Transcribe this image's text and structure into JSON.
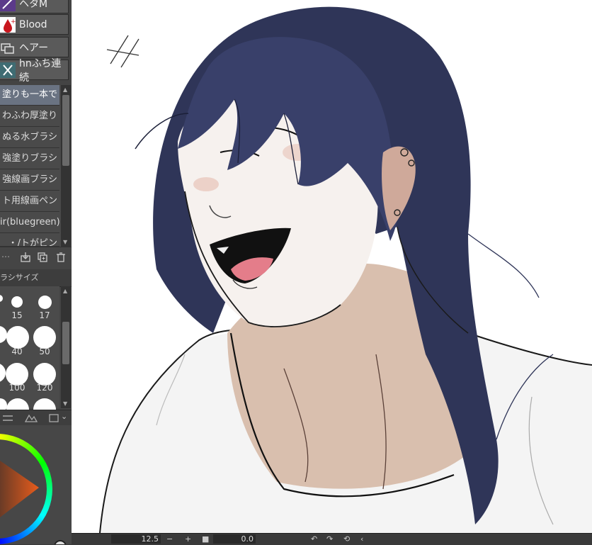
{
  "sub_tools": [
    {
      "label": "ヘタM",
      "icon": "feather-brush-icon"
    },
    {
      "label": "Blood",
      "icon": "blood-drop-icon"
    },
    {
      "label": "ヘアー",
      "icon": "hair-brush-icon"
    },
    {
      "label": "hnふち連続",
      "icon": "x-brush-icon"
    }
  ],
  "brushes": [
    {
      "label": "塗りも一本で",
      "selected": true
    },
    {
      "label": "わふわ厚塗り",
      "selected": false
    },
    {
      "label": "ぬる水ブラシ",
      "selected": false
    },
    {
      "label": "強塗りブラシ",
      "selected": false
    },
    {
      "label": "強線画ブラシ",
      "selected": false
    },
    {
      "label": "ト用線画ペン",
      "selected": false
    },
    {
      "label": "ir(bluegreen)",
      "selected": false
    },
    {
      "label": "・/トがピン",
      "selected": false
    }
  ],
  "brush_size_panel": {
    "title": "ラシサイズ",
    "sizes": [
      "15",
      "17",
      "40",
      "50",
      "100",
      "120"
    ]
  },
  "status": {
    "zoom": "12.5",
    "angle": "0.0",
    "minus": "−",
    "plus": "+"
  },
  "colors": {
    "accent_selected": "#6a7382",
    "canvas_bg": "#ffffff",
    "hair": "#2f3558"
  }
}
